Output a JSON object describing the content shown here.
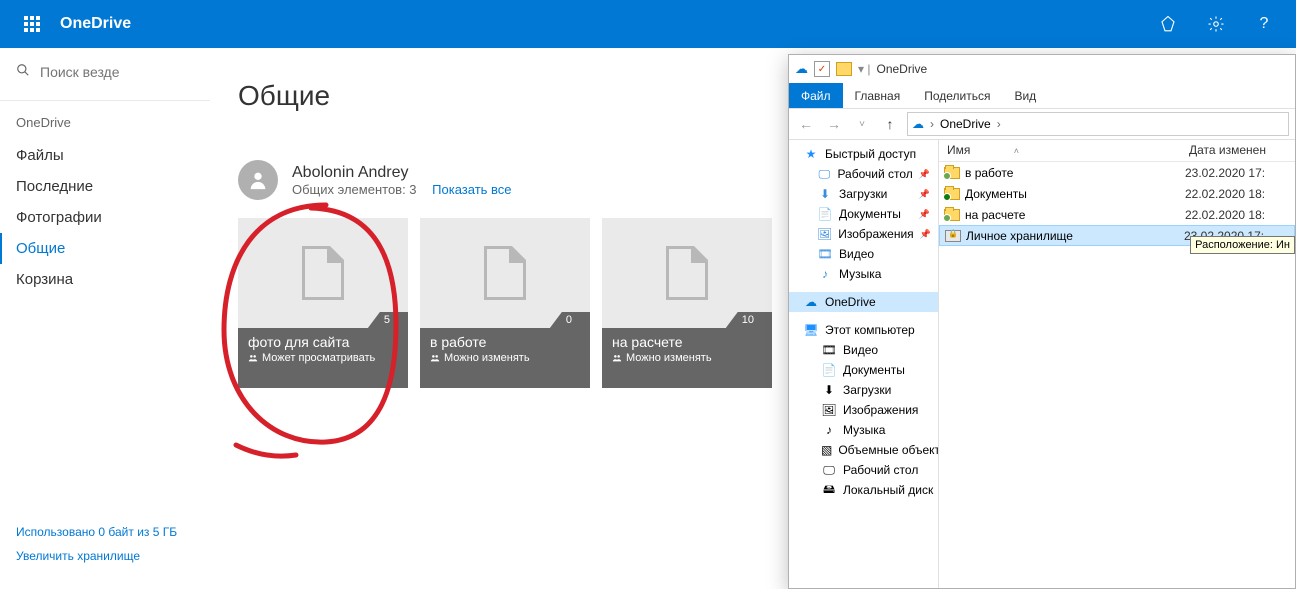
{
  "topbar": {
    "brand": "OneDrive"
  },
  "search": {
    "placeholder": "Поиск везде"
  },
  "nav": {
    "heading": "OneDrive",
    "items": [
      "Файлы",
      "Последние",
      "Фотографии",
      "Общие",
      "Корзина"
    ],
    "active": 3
  },
  "sidebarFooter": {
    "usage": "Использовано 0 байт из 5 ГБ",
    "upgrade": "Увеличить хранилище"
  },
  "main": {
    "title": "Общие",
    "owner": {
      "name": "Abolonin Andrey",
      "sub": "Общих элементов: 3",
      "link": "Показать все"
    },
    "tiles": [
      {
        "name": "фото для сайта",
        "count": "5",
        "perm": "Может просматривать"
      },
      {
        "name": "в работе",
        "count": "0",
        "perm": "Можно изменять"
      },
      {
        "name": "на расчете",
        "count": "10",
        "perm": "Можно изменять"
      }
    ]
  },
  "explorer": {
    "title": "OneDrive",
    "ribbon": {
      "file": "Файл",
      "tabs": [
        "Главная",
        "Поделиться",
        "Вид"
      ]
    },
    "address": {
      "root": "OneDrive"
    },
    "tree": {
      "quick": "Быстрый доступ",
      "quickItems": [
        {
          "label": "Рабочий стол",
          "icon": "🖵",
          "color": "#3a8dde"
        },
        {
          "label": "Загрузки",
          "icon": "⬇",
          "color": "#3a8dde"
        },
        {
          "label": "Документы",
          "icon": "📄",
          "color": "#3a8dde"
        },
        {
          "label": "Изображения",
          "icon": "🖼",
          "color": "#3a8dde"
        },
        {
          "label": "Видео",
          "icon": "🎞",
          "color": "#3a8dde"
        },
        {
          "label": "Музыка",
          "icon": "♪",
          "color": "#3a8dde"
        }
      ],
      "onedrive": "OneDrive",
      "thispc": "Этот компьютер",
      "pcItems": [
        {
          "label": "Видео",
          "icon": "🎞"
        },
        {
          "label": "Документы",
          "icon": "📄"
        },
        {
          "label": "Загрузки",
          "icon": "⬇"
        },
        {
          "label": "Изображения",
          "icon": "🖼"
        },
        {
          "label": "Музыка",
          "icon": "♪"
        },
        {
          "label": "Объемные объекты",
          "icon": "▧"
        },
        {
          "label": "Рабочий стол",
          "icon": "🖵"
        },
        {
          "label": "Локальный диск",
          "icon": "🖴"
        }
      ]
    },
    "columns": {
      "name": "Имя",
      "date": "Дата изменен"
    },
    "files": [
      {
        "name": "в работе",
        "date": "23.02.2020 17:",
        "type": "shared-folder"
      },
      {
        "name": "Документы",
        "date": "22.02.2020 18:",
        "type": "synced-folder"
      },
      {
        "name": "на расчете",
        "date": "22.02.2020 18:",
        "type": "shared-folder"
      },
      {
        "name": "Личное хранилище",
        "date": "23.02.2020 17:",
        "type": "vault",
        "selected": true
      }
    ],
    "tooltip": "Расположение: Ин"
  }
}
